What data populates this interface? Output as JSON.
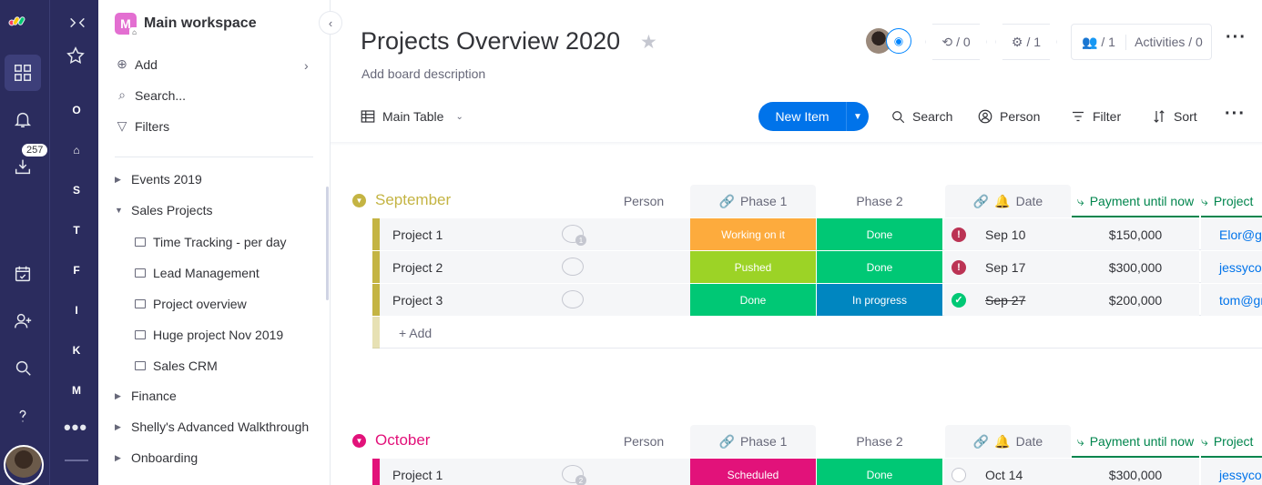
{
  "rail": {
    "badge": "257",
    "workspaces": [
      {
        "letter": "O",
        "color": "#0085ff"
      },
      {
        "letter": "⌂",
        "color": "#579bfc"
      },
      {
        "letter": "S",
        "color": "#00c875"
      },
      {
        "letter": "T",
        "color": "#579bfc"
      },
      {
        "letter": "F",
        "color": "#ff642e"
      },
      {
        "letter": "I",
        "color": "#ff642e"
      },
      {
        "letter": "K",
        "color": "#cab641"
      },
      {
        "letter": "M",
        "color": "#e36fd1"
      }
    ]
  },
  "sidebar": {
    "workspace_letter": "M",
    "workspace_name": "Main workspace",
    "add": "Add",
    "search": "Search...",
    "filters": "Filters",
    "folders": {
      "events": "Events 2019",
      "sales": "Sales Projects",
      "finance": "Finance",
      "shelly": "Shelly's Advanced Walkthrough",
      "onboarding": "Onboarding"
    },
    "boards": [
      "Time Tracking - per day",
      "Lead Management",
      "Project overview",
      "Huge project Nov 2019",
      "Sales CRM"
    ]
  },
  "header": {
    "title": "Projects Overview 2020",
    "description": "Add board description",
    "integrations": "/ 0",
    "automations": "/ 1",
    "members": "/ 1",
    "activities": "Activities / 0"
  },
  "toolbar": {
    "view": "Main Table",
    "new_item": "New Item",
    "search": "Search",
    "person": "Person",
    "filter": "Filter",
    "sort": "Sort"
  },
  "columns": {
    "person": "Person",
    "phase1": "Phase 1",
    "phase2": "Phase 2",
    "date": "Date",
    "payment": "Payment until now",
    "project": "Project"
  },
  "colors": {
    "september": "#c4b443",
    "october": "#e2127a",
    "working_on_it": "#fdab3d",
    "done": "#00c875",
    "pushed": "#9cd326",
    "in_progress": "#0086c0",
    "scheduled": "#e2127a",
    "alert": "#bb3354",
    "primary": "#0073ea"
  },
  "groups": {
    "september": {
      "title": "September",
      "add": "+ Add",
      "rows": [
        {
          "name": "Project 1",
          "updates": "1",
          "phase1": "Working on it",
          "phase2": "Done",
          "date": "Sep 10",
          "payment": "$150,000",
          "email": "Elor@gm"
        },
        {
          "name": "Project 2",
          "phase1": "Pushed",
          "phase2": "Done",
          "date": "Sep 17",
          "payment": "$300,000",
          "email": "jessycohe"
        },
        {
          "name": "Project 3",
          "phase1": "Done",
          "phase2": "In progress",
          "date": "Sep 27",
          "payment": "$200,000",
          "email": "tom@gm"
        }
      ]
    },
    "october": {
      "title": "October",
      "rows": [
        {
          "name": "Project 1",
          "updates": "2",
          "phase1": "Scheduled",
          "phase2": "Done",
          "date": "Oct 14",
          "payment": "$300,000",
          "email": "jessycohe"
        }
      ]
    }
  }
}
